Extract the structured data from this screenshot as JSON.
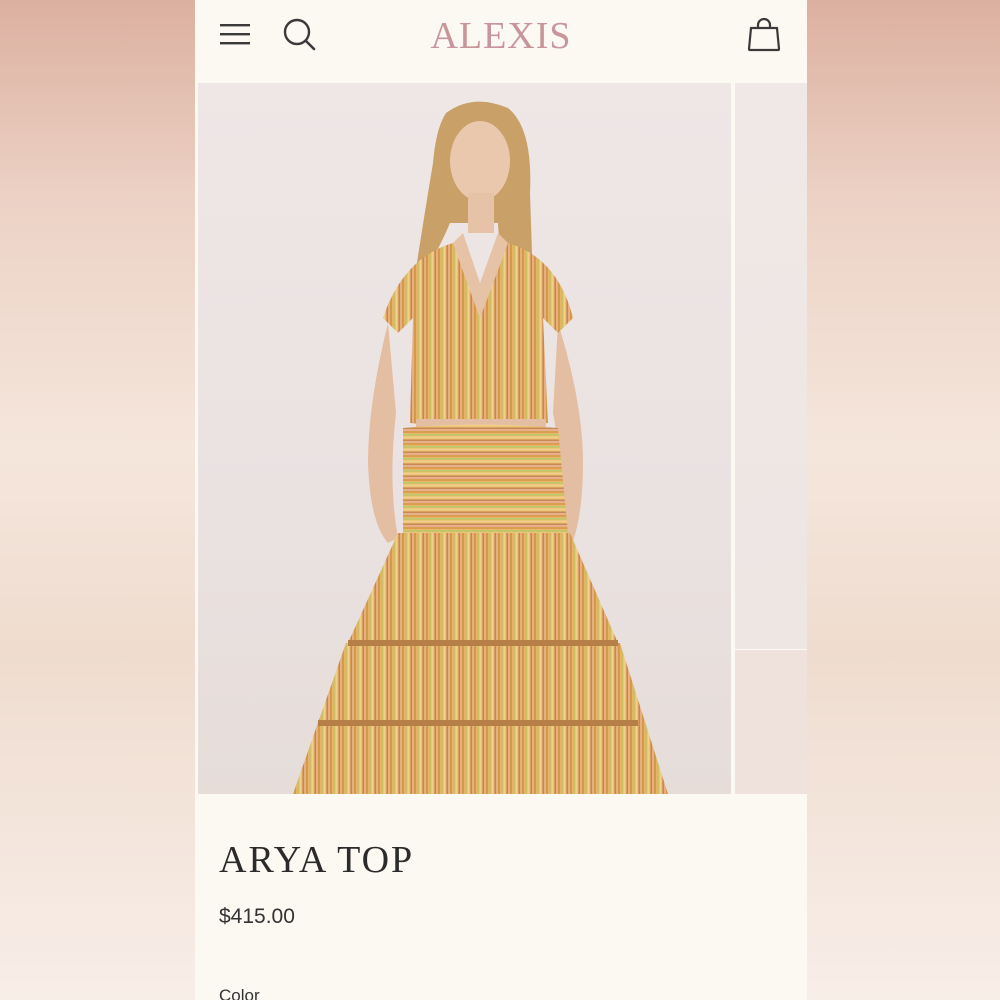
{
  "header": {
    "logo": "ALEXIS",
    "icons": {
      "menu": "hamburger-menu-icon",
      "search": "search-icon",
      "cart": "shopping-bag-icon"
    }
  },
  "product": {
    "title": "ARYA TOP",
    "price": "$415.00",
    "color_label": "Color"
  },
  "colors": {
    "logo": "#c8969a",
    "background": "#fcf8f2",
    "text": "#2b2b2b"
  }
}
